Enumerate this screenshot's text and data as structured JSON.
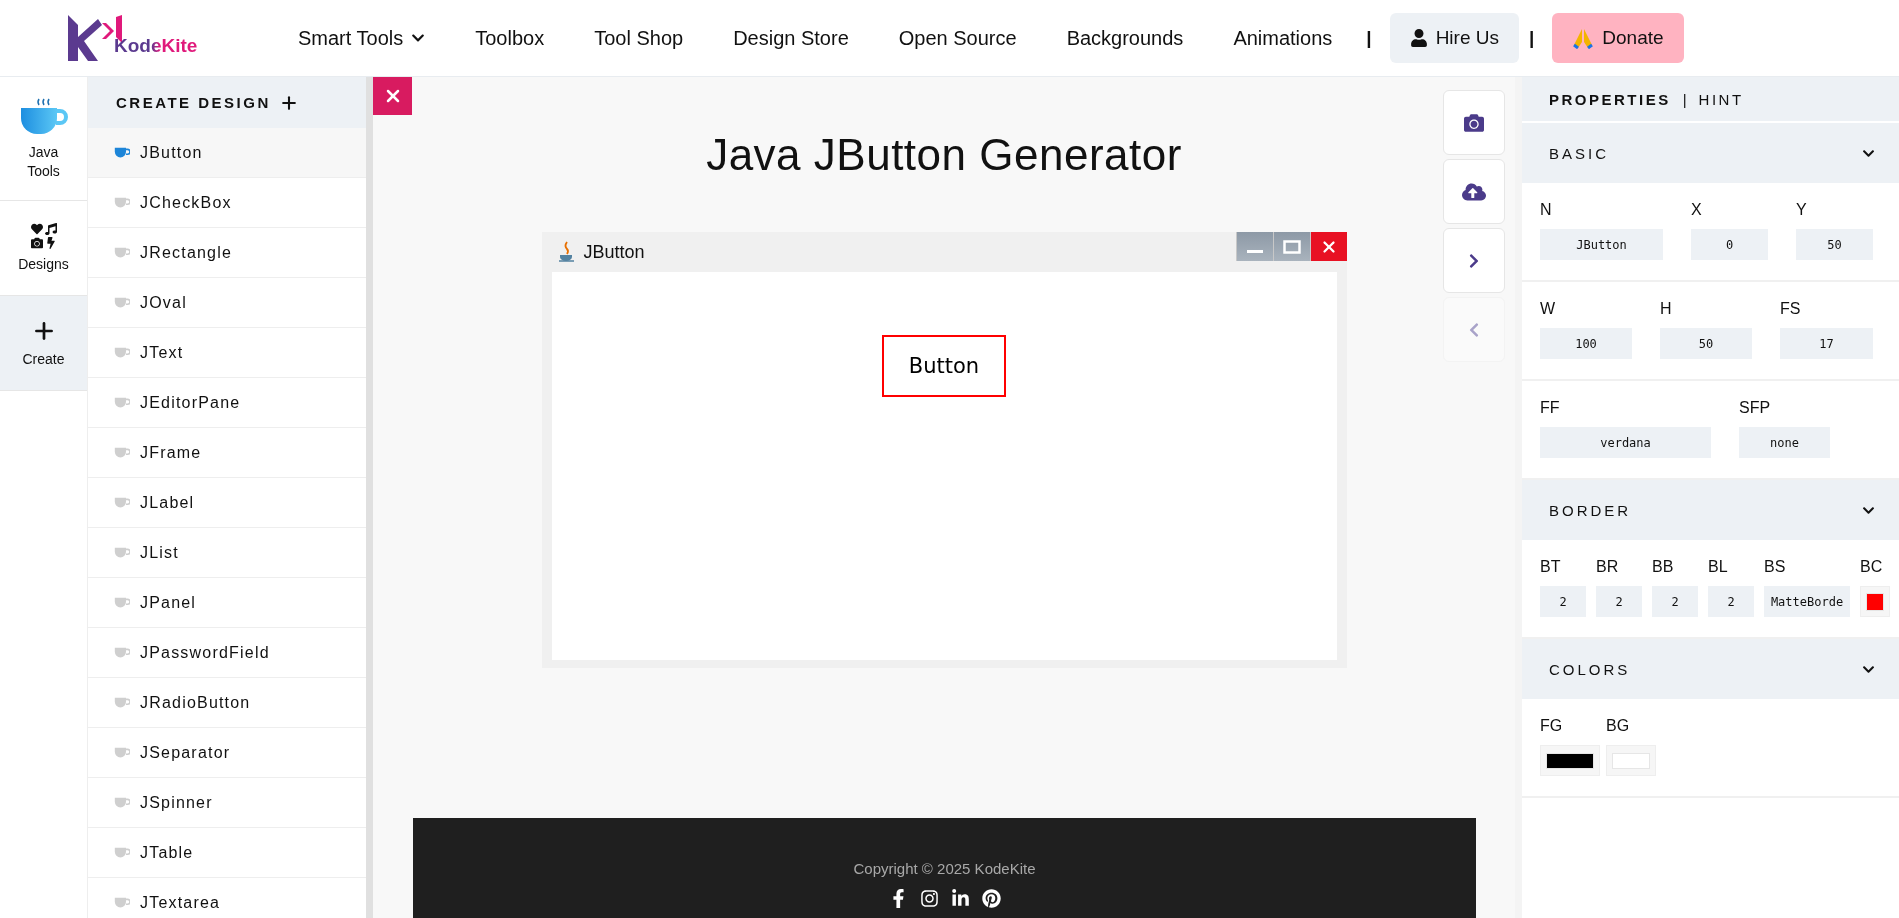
{
  "header": {
    "logo_text": "KodeKite",
    "nav": [
      {
        "label": "Smart Tools",
        "has_dropdown": true
      },
      {
        "label": "Toolbox",
        "has_dropdown": false
      },
      {
        "label": "Tool Shop",
        "has_dropdown": false
      },
      {
        "label": "Design Store",
        "has_dropdown": false
      },
      {
        "label": "Open Source",
        "has_dropdown": false
      },
      {
        "label": "Backgrounds",
        "has_dropdown": false
      },
      {
        "label": "Animations",
        "has_dropdown": false
      }
    ],
    "separators": [
      "|",
      "|"
    ],
    "hire_button": "Hire Us",
    "donate_button": "Donate"
  },
  "rail": [
    {
      "kind": "java",
      "label": "Java Tools",
      "selected": false
    },
    {
      "kind": "designs",
      "label": "Designs",
      "selected": false
    },
    {
      "kind": "create",
      "label": "Create",
      "selected": true
    }
  ],
  "sidebar": {
    "title": "CREATE DESIGN",
    "items": [
      {
        "label": "JButton",
        "selected": true
      },
      {
        "label": "JCheckBox",
        "selected": false
      },
      {
        "label": "JRectangle",
        "selected": false
      },
      {
        "label": "JOval",
        "selected": false
      },
      {
        "label": "JText",
        "selected": false
      },
      {
        "label": "JEditorPane",
        "selected": false
      },
      {
        "label": "JFrame",
        "selected": false
      },
      {
        "label": "JLabel",
        "selected": false
      },
      {
        "label": "JList",
        "selected": false
      },
      {
        "label": "JPanel",
        "selected": false
      },
      {
        "label": "JPasswordField",
        "selected": false
      },
      {
        "label": "JRadioButton",
        "selected": false
      },
      {
        "label": "JSeparator",
        "selected": false
      },
      {
        "label": "JSpinner",
        "selected": false
      },
      {
        "label": "JTable",
        "selected": false
      },
      {
        "label": "JTextarea",
        "selected": false
      }
    ]
  },
  "canvas": {
    "title": "Java JButton Generator",
    "frame": {
      "title": "JButton",
      "button_label": "Button"
    },
    "tools": [
      {
        "kind": "camera",
        "disabled": false
      },
      {
        "kind": "upload",
        "disabled": false
      },
      {
        "kind": "next",
        "disabled": false
      },
      {
        "kind": "previous",
        "disabled": true
      }
    ]
  },
  "properties": {
    "tabs": [
      {
        "label": "PROPERTIES",
        "selected": true
      },
      {
        "label": "HINT",
        "selected": false
      }
    ],
    "tab_separator": "|",
    "sections": [
      {
        "title": "BASIC",
        "expanded": true,
        "rows": [
          [
            {
              "label": "N",
              "value": "JButton",
              "kind": "text"
            },
            {
              "label": "X",
              "value": "0",
              "kind": "text"
            },
            {
              "label": "Y",
              "value": "50",
              "kind": "text"
            }
          ],
          [
            {
              "label": "W",
              "value": "100",
              "kind": "text"
            },
            {
              "label": "H",
              "value": "50",
              "kind": "text"
            },
            {
              "label": "FS",
              "value": "17",
              "kind": "text"
            }
          ],
          [
            {
              "label": "FF",
              "value": "verdana",
              "kind": "text"
            },
            {
              "label": "SFP",
              "value": "none",
              "kind": "text"
            }
          ]
        ]
      },
      {
        "title": "BORDER",
        "expanded": true,
        "rows": [
          [
            {
              "label": "BT",
              "value": "2",
              "kind": "text"
            },
            {
              "label": "BR",
              "value": "2",
              "kind": "text"
            },
            {
              "label": "BB",
              "value": "2",
              "kind": "text"
            },
            {
              "label": "BL",
              "value": "2",
              "kind": "text"
            },
            {
              "label": "BS",
              "value": "MatteBorde",
              "kind": "text"
            },
            {
              "label": "BC",
              "kind": "color",
              "color": "#ff0000"
            }
          ]
        ]
      },
      {
        "title": "COLORS",
        "expanded": true,
        "rows": [
          [
            {
              "label": "FG",
              "kind": "color",
              "color": "#000000"
            },
            {
              "label": "BG",
              "kind": "color",
              "color": "#ffffff"
            }
          ]
        ]
      }
    ]
  },
  "footer": {
    "copyright": "Copyright © 2025 KodeKite",
    "social": [
      {
        "kind": "facebook"
      },
      {
        "kind": "instagram"
      },
      {
        "kind": "linkedin"
      },
      {
        "kind": "pinterest"
      }
    ]
  }
}
